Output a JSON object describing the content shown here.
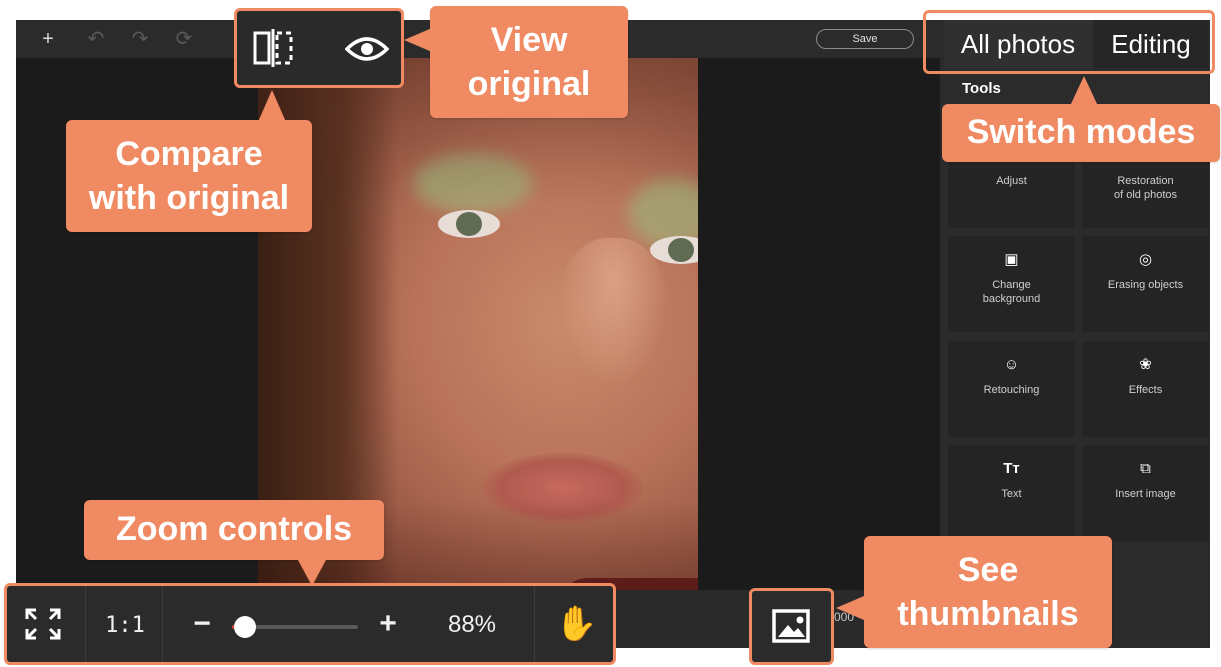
{
  "toolbar": {
    "icons": [
      "plus-icon",
      "undo-icon",
      "redo-icon",
      "sync-icon"
    ],
    "save_label": "Save"
  },
  "compare_controls": {
    "compare_icon": "split-compare-icon",
    "view_icon": "eye-icon"
  },
  "mode_tabs": {
    "all_photos": "All photos",
    "editing": "Editing"
  },
  "panel": {
    "tools_title": "Tools",
    "tools": [
      {
        "label": "Adjust",
        "icon": "sliders-icon"
      },
      {
        "label": "Restoration\nof old photos",
        "icon": "wand-icon"
      },
      {
        "label": "Change\nbackground",
        "icon": "background-icon"
      },
      {
        "label": "Erasing objects",
        "icon": "eraser-icon"
      },
      {
        "label": "Retouching",
        "icon": "smiley-icon"
      },
      {
        "label": "Effects",
        "icon": "effects-icon"
      },
      {
        "label": "Text",
        "icon": "text-icon"
      },
      {
        "label": "Insert image",
        "icon": "insert-image-icon"
      }
    ]
  },
  "zoom": {
    "fullscreen_icon": "fit-screen-icon",
    "one_to_one": "1:1",
    "minus": "−",
    "plus": "+",
    "percent": "88%",
    "level_fraction": 0.1,
    "hand_icon": "hand-icon"
  },
  "thumbnails": {
    "icon": "image-icon",
    "partial_text": "000"
  },
  "callouts": {
    "view_original": "View\noriginal",
    "compare": "Compare\nwith original",
    "switch_modes": "Switch modes",
    "zoom_controls": "Zoom controls",
    "see_thumbnails": "See\nthumbnails"
  },
  "colors": {
    "accent": "#ef8a62",
    "panel_bg": "#2b2b2b",
    "canvas_bg": "#1b1b1b"
  }
}
